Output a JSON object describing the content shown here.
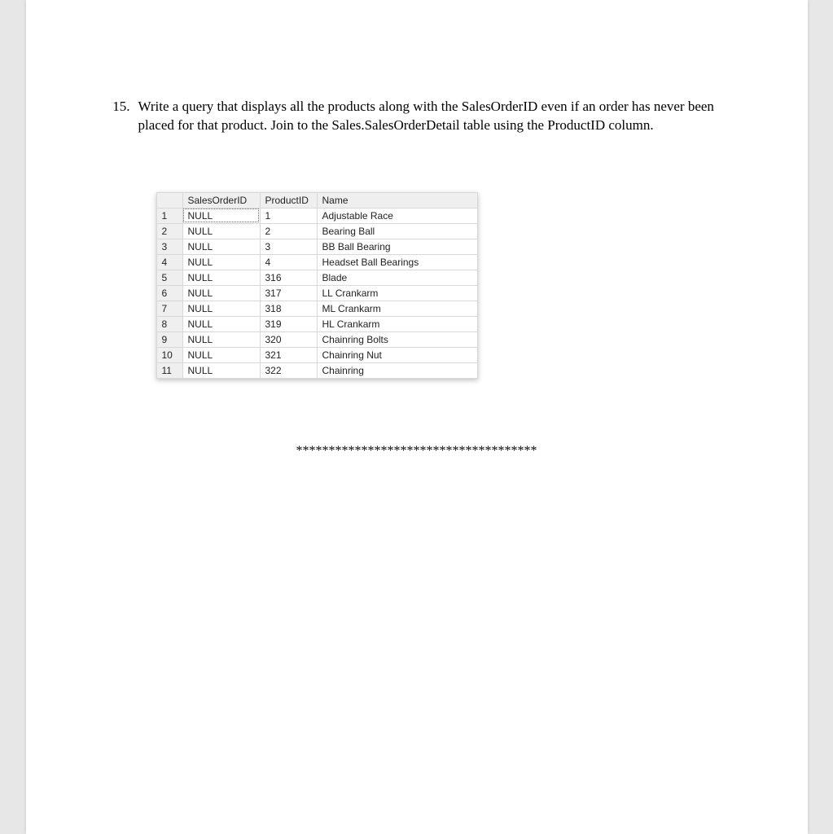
{
  "question": {
    "number": "15.",
    "text": "Write a query that displays all the products along with the SalesOrderID even if an order has never been placed for that product. Join to the Sales.SalesOrderDetail table using the ProductID column."
  },
  "grid": {
    "headers": [
      "SalesOrderID",
      "ProductID",
      "Name"
    ],
    "rows": [
      {
        "n": "1",
        "c": [
          "NULL",
          "1",
          "Adjustable Race"
        ]
      },
      {
        "n": "2",
        "c": [
          "NULL",
          "2",
          "Bearing Ball"
        ]
      },
      {
        "n": "3",
        "c": [
          "NULL",
          "3",
          "BB Ball Bearing"
        ]
      },
      {
        "n": "4",
        "c": [
          "NULL",
          "4",
          "Headset Ball Bearings"
        ]
      },
      {
        "n": "5",
        "c": [
          "NULL",
          "316",
          "Blade"
        ]
      },
      {
        "n": "6",
        "c": [
          "NULL",
          "317",
          "LL Crankarm"
        ]
      },
      {
        "n": "7",
        "c": [
          "NULL",
          "318",
          "ML Crankarm"
        ]
      },
      {
        "n": "8",
        "c": [
          "NULL",
          "319",
          "HL Crankarm"
        ]
      },
      {
        "n": "9",
        "c": [
          "NULL",
          "320",
          "Chainring Bolts"
        ]
      },
      {
        "n": "10",
        "c": [
          "NULL",
          "321",
          "Chainring Nut"
        ]
      },
      {
        "n": "11",
        "c": [
          "NULL",
          "322",
          "Chainring"
        ]
      }
    ],
    "selected_cell": {
      "row": 0,
      "col": 0
    }
  },
  "separator": "*************************************"
}
